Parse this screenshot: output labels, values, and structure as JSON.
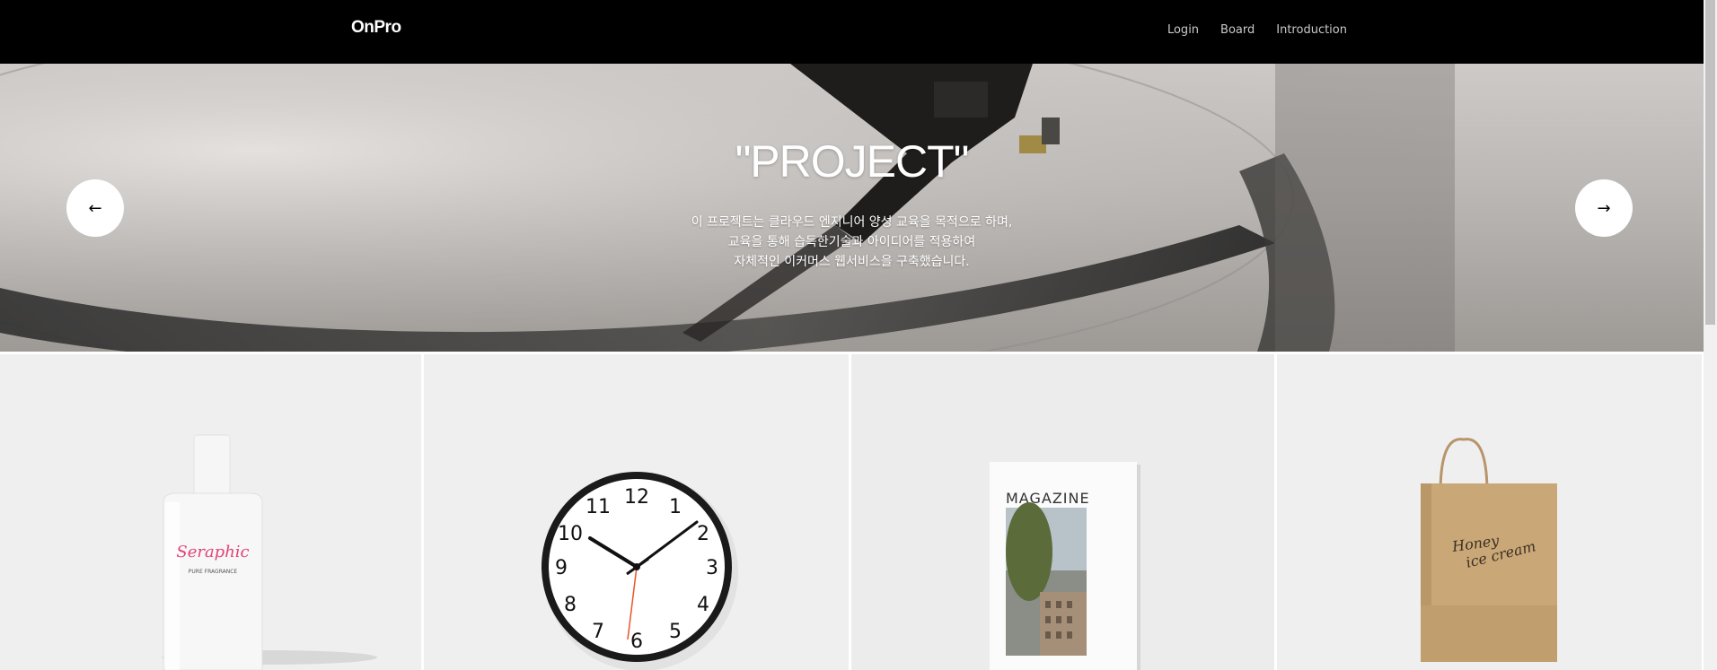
{
  "header": {
    "logo": "OnPro",
    "nav": [
      {
        "label": "Login"
      },
      {
        "label": "Board"
      },
      {
        "label": "Introduction"
      }
    ]
  },
  "hero": {
    "title": "\"PROJECT\"",
    "description": [
      "이 프로젝트는 클라우드 엔지니어 양성 교육을 목적으로 하며,",
      "교육을 통해 습득한기술과 아이디어를 적용하여",
      "자체적인 이커머스 웹서비스을 구축했습니다."
    ],
    "prev_icon": "arrow-left-icon",
    "next_icon": "arrow-right-icon"
  },
  "products": [
    {
      "name": "perfume",
      "brand": "Seraphic",
      "subtitle": "PURE FRAGRANCE"
    },
    {
      "name": "clock",
      "numbers": [
        "12",
        "1",
        "2",
        "3",
        "4",
        "5",
        "6",
        "7",
        "8",
        "9",
        "10",
        "11"
      ]
    },
    {
      "name": "magazine",
      "title": "MAGAZINE"
    },
    {
      "name": "bag",
      "line1": "Honey",
      "line2": "ice cream"
    }
  ],
  "colors": {
    "topbar": "#000000",
    "tile_bg": "#efefef",
    "seraphic_pink": "#e0457b",
    "clock_hand_red": "#e8562a",
    "bag_kraft": "#c9a777"
  }
}
